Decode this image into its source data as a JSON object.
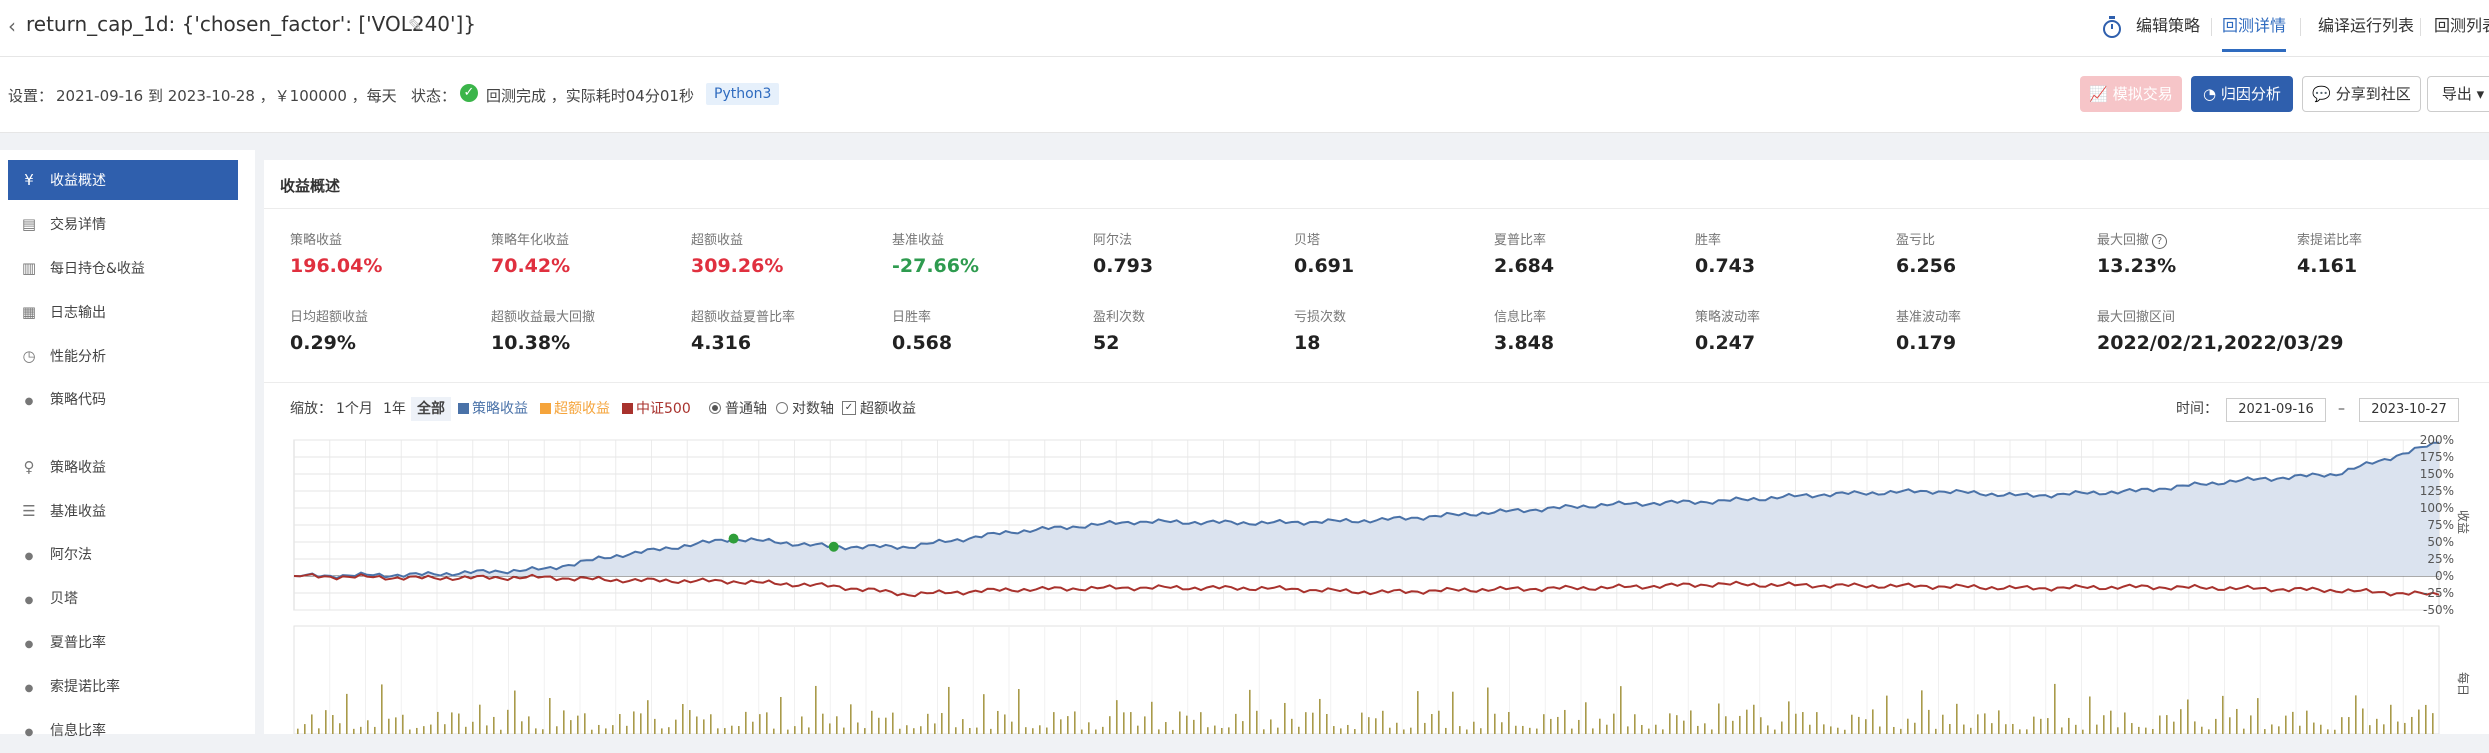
{
  "header": {
    "back_icon": "chevron-left-icon",
    "title": "return_cap_1d: {'chosen_factor': ['VOL240']}",
    "edit_icon": "pencil-icon",
    "nav": {
      "edit_strategy": "编辑策略",
      "backtest_detail": "回测详情",
      "compile_list": "编译运行列表",
      "backtest_list": "回测列表"
    },
    "stopwatch_icon": "stopwatch-icon"
  },
  "settings": {
    "label": "设置：",
    "period": "2021-09-16 到 2023-10-28 ，￥100000 ，每天",
    "status_label": "状态：",
    "status_text": "回测完成 ，实际耗时04分01秒",
    "language": "Python3"
  },
  "actions": {
    "simulate": "模拟交易",
    "attribution": "归因分析",
    "share": "分享到社区",
    "export": "导出"
  },
  "sidebar": {
    "items": [
      {
        "label": "收益概述",
        "icon": "yen-icon",
        "active": true
      },
      {
        "label": "交易详情",
        "icon": "document-icon"
      },
      {
        "label": "每日持仓&收益",
        "icon": "bar-chart-icon"
      },
      {
        "label": "日志输出",
        "icon": "calendar-icon"
      },
      {
        "label": "性能分析",
        "icon": "clock-icon"
      },
      {
        "label": "策略代码",
        "icon": "bullet-icon"
      },
      {
        "label": "策略收益",
        "icon": "bulb-icon"
      },
      {
        "label": "基准收益",
        "icon": "database-icon"
      },
      {
        "label": "阿尔法",
        "icon": "bullet-icon"
      },
      {
        "label": "贝塔",
        "icon": "bullet-icon"
      },
      {
        "label": "夏普比率",
        "icon": "bullet-icon"
      },
      {
        "label": "索提诺比率",
        "icon": "bullet-icon"
      },
      {
        "label": "信息比率",
        "icon": "bullet-icon"
      }
    ]
  },
  "summary": {
    "title": "收益概述",
    "row1": [
      {
        "label": "策略收益",
        "value": "196.04%",
        "color": "red"
      },
      {
        "label": "策略年化收益",
        "value": "70.42%",
        "color": "red"
      },
      {
        "label": "超额收益",
        "value": "309.26%",
        "color": "red"
      },
      {
        "label": "基准收益",
        "value": "-27.66%",
        "color": "green"
      },
      {
        "label": "阿尔法",
        "value": "0.793"
      },
      {
        "label": "贝塔",
        "value": "0.691"
      },
      {
        "label": "夏普比率",
        "value": "2.684"
      },
      {
        "label": "胜率",
        "value": "0.743"
      },
      {
        "label": "盈亏比",
        "value": "6.256"
      },
      {
        "label": "最大回撤",
        "value": "13.23%",
        "help": "?"
      },
      {
        "label": "索提诺比率",
        "value": "4.161"
      }
    ],
    "row2": [
      {
        "label": "日均超额收益",
        "value": "0.29%"
      },
      {
        "label": "超额收益最大回撤",
        "value": "10.38%"
      },
      {
        "label": "超额收益夏普比率",
        "value": "4.316"
      },
      {
        "label": "日胜率",
        "value": "0.568"
      },
      {
        "label": "盈利次数",
        "value": "52"
      },
      {
        "label": "亏损次数",
        "value": "18"
      },
      {
        "label": "信息比率",
        "value": "3.848"
      },
      {
        "label": "策略波动率",
        "value": "0.247"
      },
      {
        "label": "基准波动率",
        "value": "0.179"
      },
      {
        "label": "最大回撤区间",
        "value": "2022/02/21,2022/03/29"
      }
    ]
  },
  "chart_controls": {
    "zoom_label": "缩放：",
    "zoom_1m": "1个月",
    "zoom_1y": "1年",
    "zoom_all": "全部",
    "legend_strategy": "策略收益",
    "legend_excess": "超额收益",
    "legend_benchmark": "中证500",
    "axis_normal": "普通轴",
    "axis_log": "对数轴",
    "excess_toggle": "超额收益",
    "time_label": "时间：",
    "date_from": "2021-09-16",
    "date_sep": "–",
    "date_to": "2023-10-27",
    "colors": {
      "strategy": "#4a72a8",
      "excess": "#f5a43b",
      "benchmark": "#a8322d"
    }
  },
  "chart_data": {
    "type": "line",
    "x_range": [
      "2021-09-16",
      "2023-10-27"
    ],
    "ylim": [
      -50,
      200
    ],
    "y_ticks": [
      "200%",
      "175%",
      "150%",
      "125%",
      "100%",
      "75%",
      "50%",
      "25%",
      "0%",
      "-25%",
      "-50%"
    ],
    "y_axis_label": "收益",
    "lower_axis_label": "每日",
    "series": [
      {
        "name": "策略收益",
        "x": [
          "2021-09-16",
          "2021-11-01",
          "2021-12-15",
          "2022-01-10",
          "2022-02-21",
          "2022-03-29",
          "2022-04-25",
          "2022-06-01",
          "2022-07-15",
          "2022-09-01",
          "2022-10-10",
          "2022-11-15",
          "2023-01-01",
          "2023-02-10",
          "2023-03-20",
          "2023-04-28",
          "2023-06-01",
          "2023-07-10",
          "2023-08-15",
          "2023-09-20",
          "2023-10-27"
        ],
        "values": [
          0,
          2,
          10,
          30,
          55,
          43,
          43,
          65,
          80,
          78,
          82,
          92,
          105,
          110,
          120,
          125,
          118,
          125,
          140,
          150,
          196
        ]
      },
      {
        "name": "中证500",
        "x": [
          "2021-09-16",
          "2021-11-01",
          "2021-12-15",
          "2022-01-10",
          "2022-02-21",
          "2022-03-29",
          "2022-04-25",
          "2022-06-01",
          "2022-07-15",
          "2022-09-01",
          "2022-10-10",
          "2022-11-15",
          "2023-01-01",
          "2023-02-10",
          "2023-03-20",
          "2023-04-28",
          "2023-06-01",
          "2023-07-10",
          "2023-08-15",
          "2023-09-20",
          "2023-10-27"
        ],
        "values": [
          0,
          -3,
          -2,
          -6,
          -8,
          -15,
          -27,
          -20,
          -17,
          -18,
          -24,
          -20,
          -17,
          -12,
          -14,
          -15,
          -18,
          -16,
          -18,
          -21,
          -27.66
        ]
      }
    ],
    "markers": [
      {
        "x": "2022-02-21",
        "y": 55
      },
      {
        "x": "2022-03-29",
        "y": 43
      }
    ]
  }
}
